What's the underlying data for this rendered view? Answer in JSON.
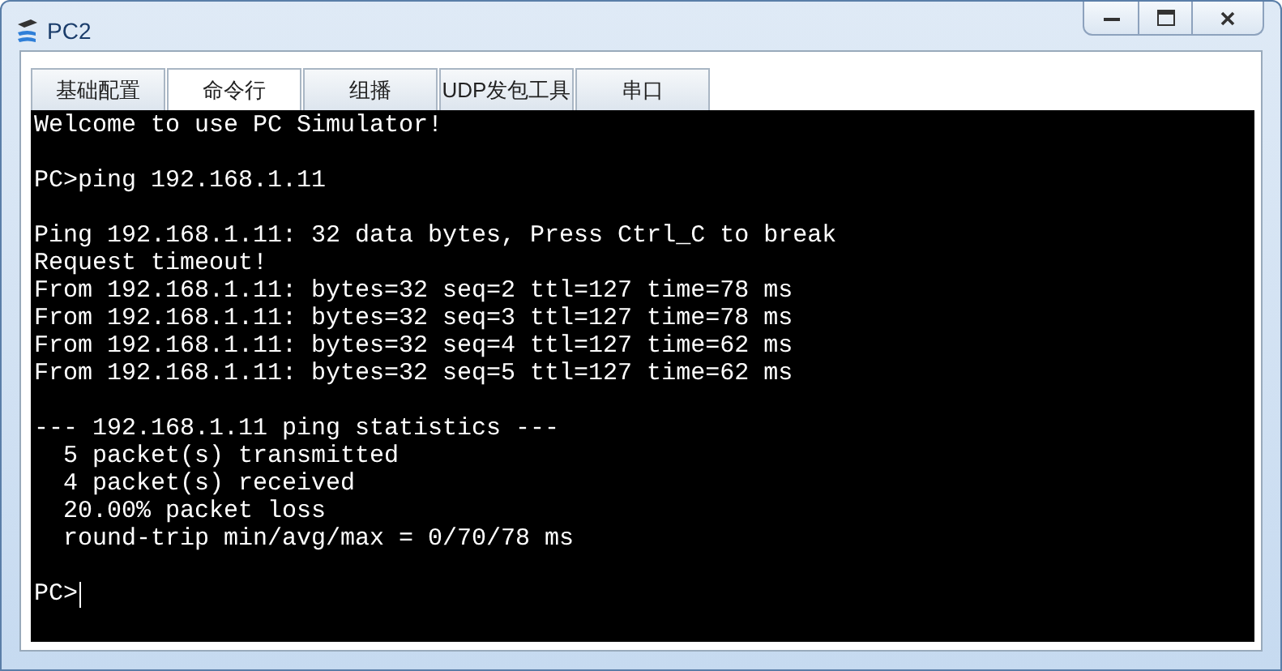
{
  "window": {
    "title": "PC2",
    "controls": [
      {
        "kind": "minimize"
      },
      {
        "kind": "maximize"
      },
      {
        "kind": "close"
      }
    ]
  },
  "tabs": [
    {
      "label": "基础配置",
      "selected": false
    },
    {
      "label": "命令行",
      "selected": true
    },
    {
      "label": "组播",
      "selected": false
    },
    {
      "label": "UDP发包工具",
      "selected": false
    },
    {
      "label": "串口",
      "selected": false
    }
  ],
  "terminal": {
    "blocks": [
      [
        "Welcome to use PC Simulator!"
      ],
      [
        "PC>ping 192.168.1.11"
      ],
      [
        "Ping 192.168.1.11: 32 data bytes, Press Ctrl_C to break",
        "Request timeout!",
        "From 192.168.1.11: bytes=32 seq=2 ttl=127 time=78 ms",
        "From 192.168.1.11: bytes=32 seq=3 ttl=127 time=78 ms",
        "From 192.168.1.11: bytes=32 seq=4 ttl=127 time=62 ms",
        "From 192.168.1.11: bytes=32 seq=5 ttl=127 time=62 ms"
      ],
      [
        "--- 192.168.1.11 ping statistics ---",
        "  5 packet(s) transmitted",
        "  4 packet(s) received",
        "  20.00% packet loss",
        "  round-trip min/avg/max = 0/70/78 ms"
      ]
    ],
    "prompt": "PC>"
  }
}
